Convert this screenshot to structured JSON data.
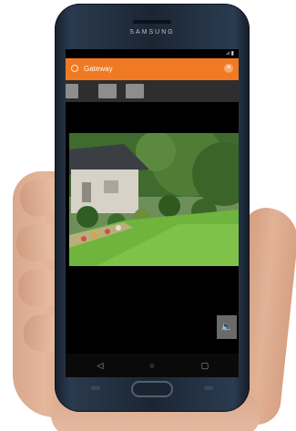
{
  "device": {
    "brand": "SAMSUNG"
  },
  "status_bar": {
    "icons": "⊿▮"
  },
  "app_bar": {
    "title": "Gateway",
    "close_glyph": "✕",
    "color": "#f07a23"
  },
  "toolbar": {
    "buttons": [
      {
        "icon": "camera-icon"
      },
      {
        "icon": "snapshot-icon"
      },
      {
        "icon": "record-icon"
      }
    ]
  },
  "video_feed": {
    "content": "live camera view of a garden with house"
  },
  "controls": {
    "mute_glyph": "🔈"
  },
  "nav_bar": {
    "back": "◁",
    "home": "○",
    "recent": "▢"
  }
}
